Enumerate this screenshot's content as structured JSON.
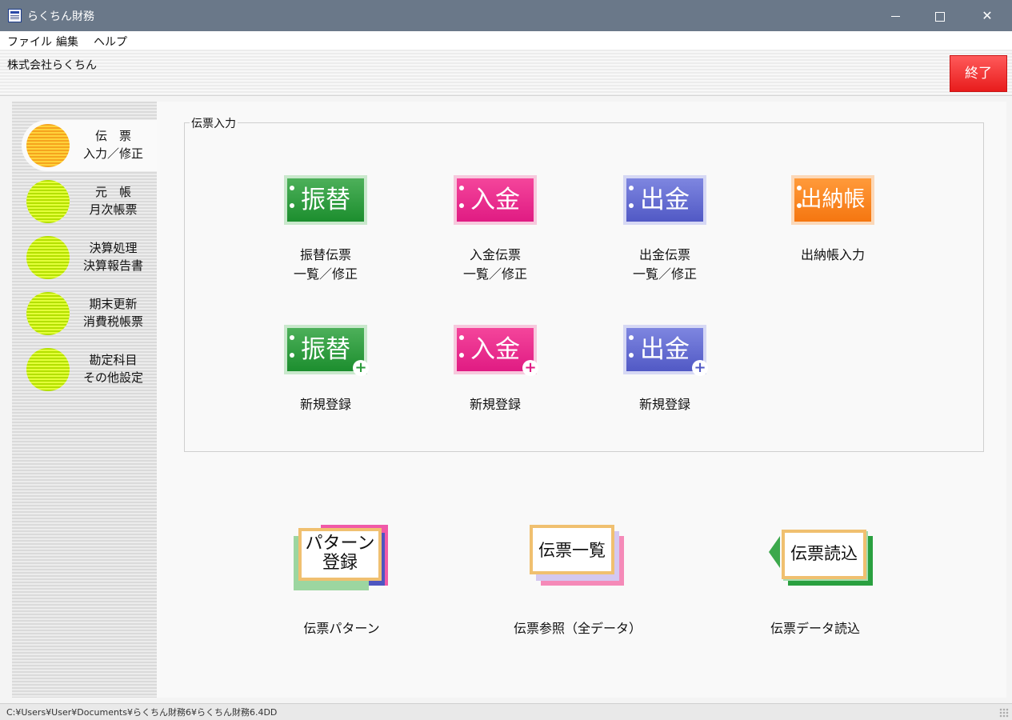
{
  "window": {
    "title": "らくちん財務"
  },
  "menu": {
    "items": [
      "ファイル",
      "編集",
      "ヘルプ"
    ]
  },
  "header": {
    "company": "株式会社らくちん",
    "exit_label": "終了"
  },
  "sidebar": {
    "items": [
      {
        "line1": "伝　票",
        "line2": "入力／修正",
        "active": true
      },
      {
        "line1": "元　帳",
        "line2": "月次帳票"
      },
      {
        "line1": "決算処理",
        "line2": "決算報告書"
      },
      {
        "line1": "期末更新",
        "line2": "消費税帳票"
      },
      {
        "line1": "勘定科目",
        "line2": "その他設定"
      }
    ]
  },
  "group": {
    "title": "伝票入力",
    "tiles": [
      {
        "icon_text": "振替",
        "line1": "振替伝票",
        "line2": "一覧／修正",
        "color": "#1c8e2e"
      },
      {
        "icon_text": "入金",
        "line1": "入金伝票",
        "line2": "一覧／修正",
        "color": "#e01b83"
      },
      {
        "icon_text": "出金",
        "line1": "出金伝票",
        "line2": "一覧／修正",
        "color": "#5159c5"
      },
      {
        "icon_text": "出納帳",
        "line1": "出納帳入力",
        "line2": "",
        "color": "#f57610"
      },
      {
        "icon_text": "振替",
        "line1": "新規登録",
        "line2": ""
      },
      {
        "icon_text": "入金",
        "line1": "新規登録",
        "line2": ""
      },
      {
        "icon_text": "出金",
        "line1": "新規登録",
        "line2": ""
      }
    ]
  },
  "bottom": {
    "pattern": {
      "card_line1": "パターン",
      "card_line2": "登録",
      "label": "伝票パターン"
    },
    "list": {
      "card_text": "伝票一覧",
      "label": "伝票参照（全データ）"
    },
    "import": {
      "card_text": "伝票読込",
      "label": "伝票データ読込"
    }
  },
  "status": {
    "path": "C:¥Users¥User¥Documents¥らくちん財務6¥らくちん財務6.4DD"
  }
}
